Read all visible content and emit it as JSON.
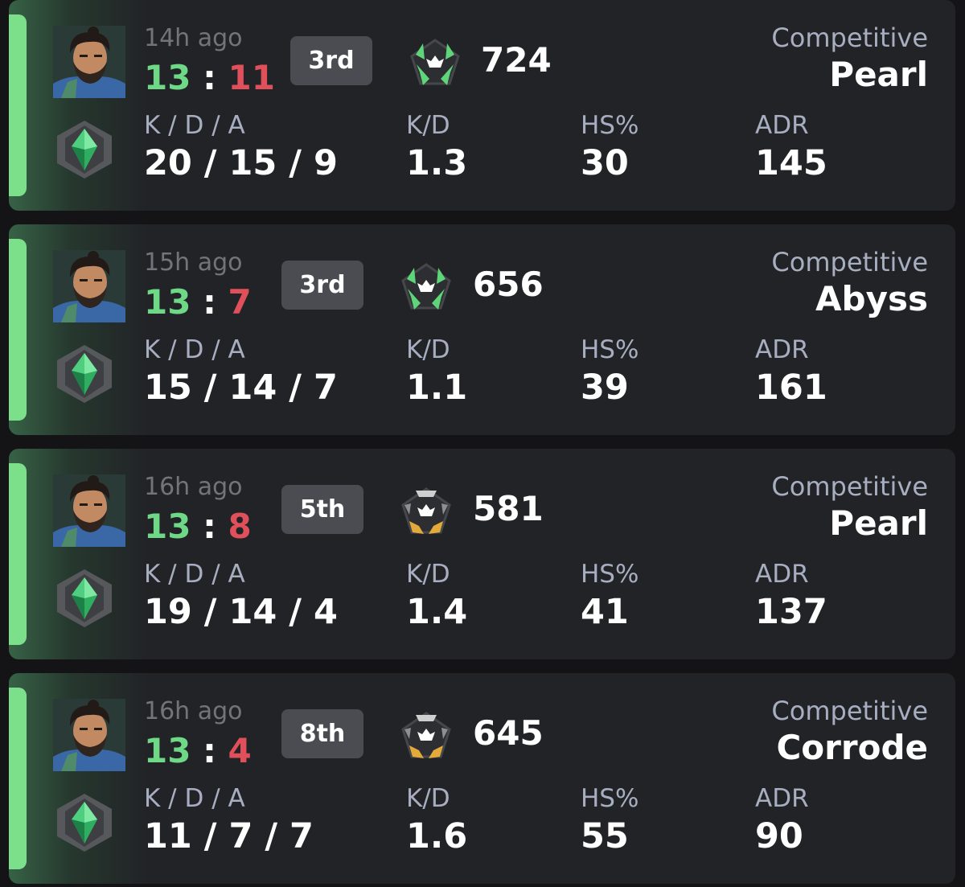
{
  "colors": {
    "win": "#6ed887",
    "loss": "#e0505a",
    "bar": "#7be089",
    "card": "#222327"
  },
  "stat_labels": {
    "kda": "K / D / A",
    "kd": "K/D",
    "hs": "HS%",
    "adr": "ADR"
  },
  "matches": [
    {
      "time": "14h ago",
      "score_for": "13",
      "score_sep": ":",
      "score_against": "11",
      "placement": "3rd",
      "rr_tier": "green",
      "rr": "724",
      "mode": "Competitive",
      "map": "Pearl",
      "kda": "20 / 15 / 9",
      "kd": "1.3",
      "hs": "30",
      "adr": "145"
    },
    {
      "time": "15h ago",
      "score_for": "13",
      "score_sep": ":",
      "score_against": "7",
      "placement": "3rd",
      "rr_tier": "green",
      "rr": "656",
      "mode": "Competitive",
      "map": "Abyss",
      "kda": "15 / 14 / 7",
      "kd": "1.1",
      "hs": "39",
      "adr": "161"
    },
    {
      "time": "16h ago",
      "score_for": "13",
      "score_sep": ":",
      "score_against": "8",
      "placement": "5th",
      "rr_tier": "gold",
      "rr": "581",
      "mode": "Competitive",
      "map": "Pearl",
      "kda": "19 / 14 / 4",
      "kd": "1.4",
      "hs": "41",
      "adr": "137"
    },
    {
      "time": "16h ago",
      "score_for": "13",
      "score_sep": ":",
      "score_against": "4",
      "placement": "8th",
      "rr_tier": "gold",
      "rr": "645",
      "mode": "Competitive",
      "map": "Corrode",
      "kda": "11 / 7 / 7",
      "kd": "1.6",
      "hs": "55",
      "adr": "90"
    }
  ]
}
